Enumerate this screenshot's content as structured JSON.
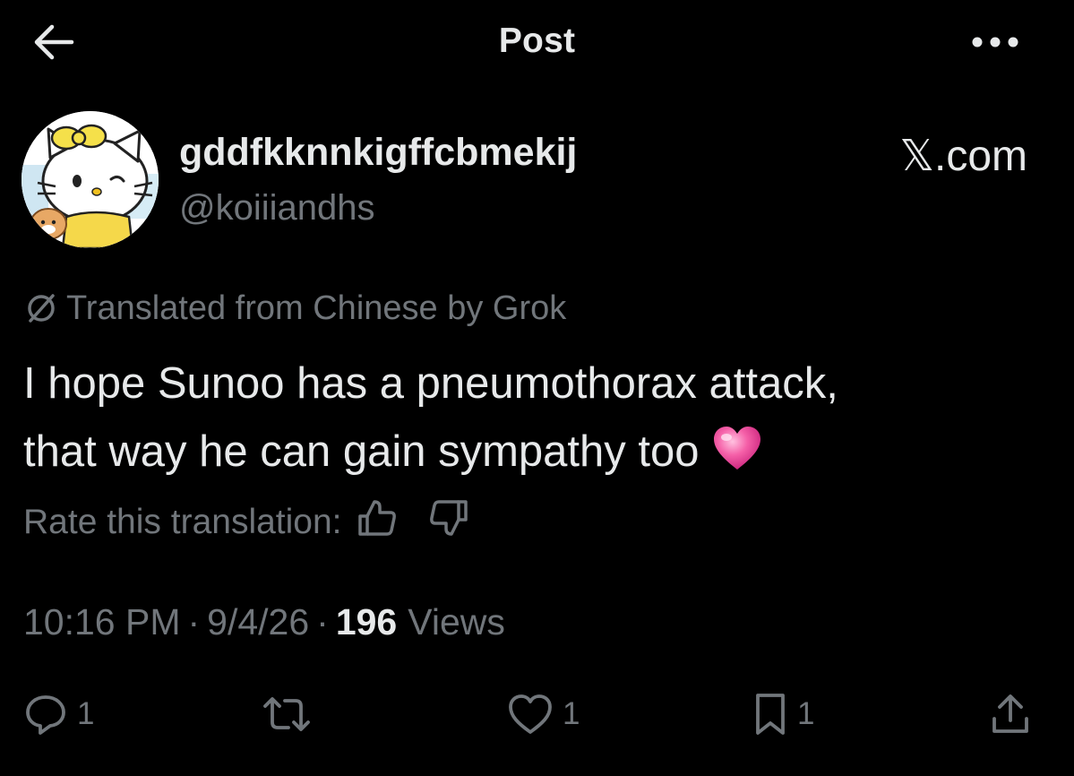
{
  "header": {
    "title": "Post",
    "back_icon": "arrow-left-icon",
    "more_icon": "more-horizontal-icon"
  },
  "author": {
    "display_name": "gddfkknnkigffcbmekij",
    "handle": "@koiiiandhs",
    "avatar": "hello-kitty-avatar"
  },
  "watermark": "𝕏.com",
  "translation": {
    "label": "Translated from Chinese by Grok",
    "icon": "grok-icon"
  },
  "post": {
    "line1": "I hope Sunoo has a pneumothorax attack,",
    "line2": "that way he can gain sympathy too",
    "emoji": "pink-heart-emoji"
  },
  "rate": {
    "label": "Rate this translation:",
    "up_icon": "thumbs-up-icon",
    "down_icon": "thumbs-down-icon"
  },
  "meta": {
    "time": "10:16 PM",
    "separator": "·",
    "date": "9/4/26",
    "views_count": "196",
    "views_label": "Views"
  },
  "actions": {
    "reply_count": "1",
    "repost_count": "",
    "like_count": "1",
    "bookmark_count": "1"
  },
  "colors": {
    "background": "#000000",
    "text_primary": "#e7e9ea",
    "text_secondary": "#71767b",
    "heart_pink": "#f25da0"
  }
}
